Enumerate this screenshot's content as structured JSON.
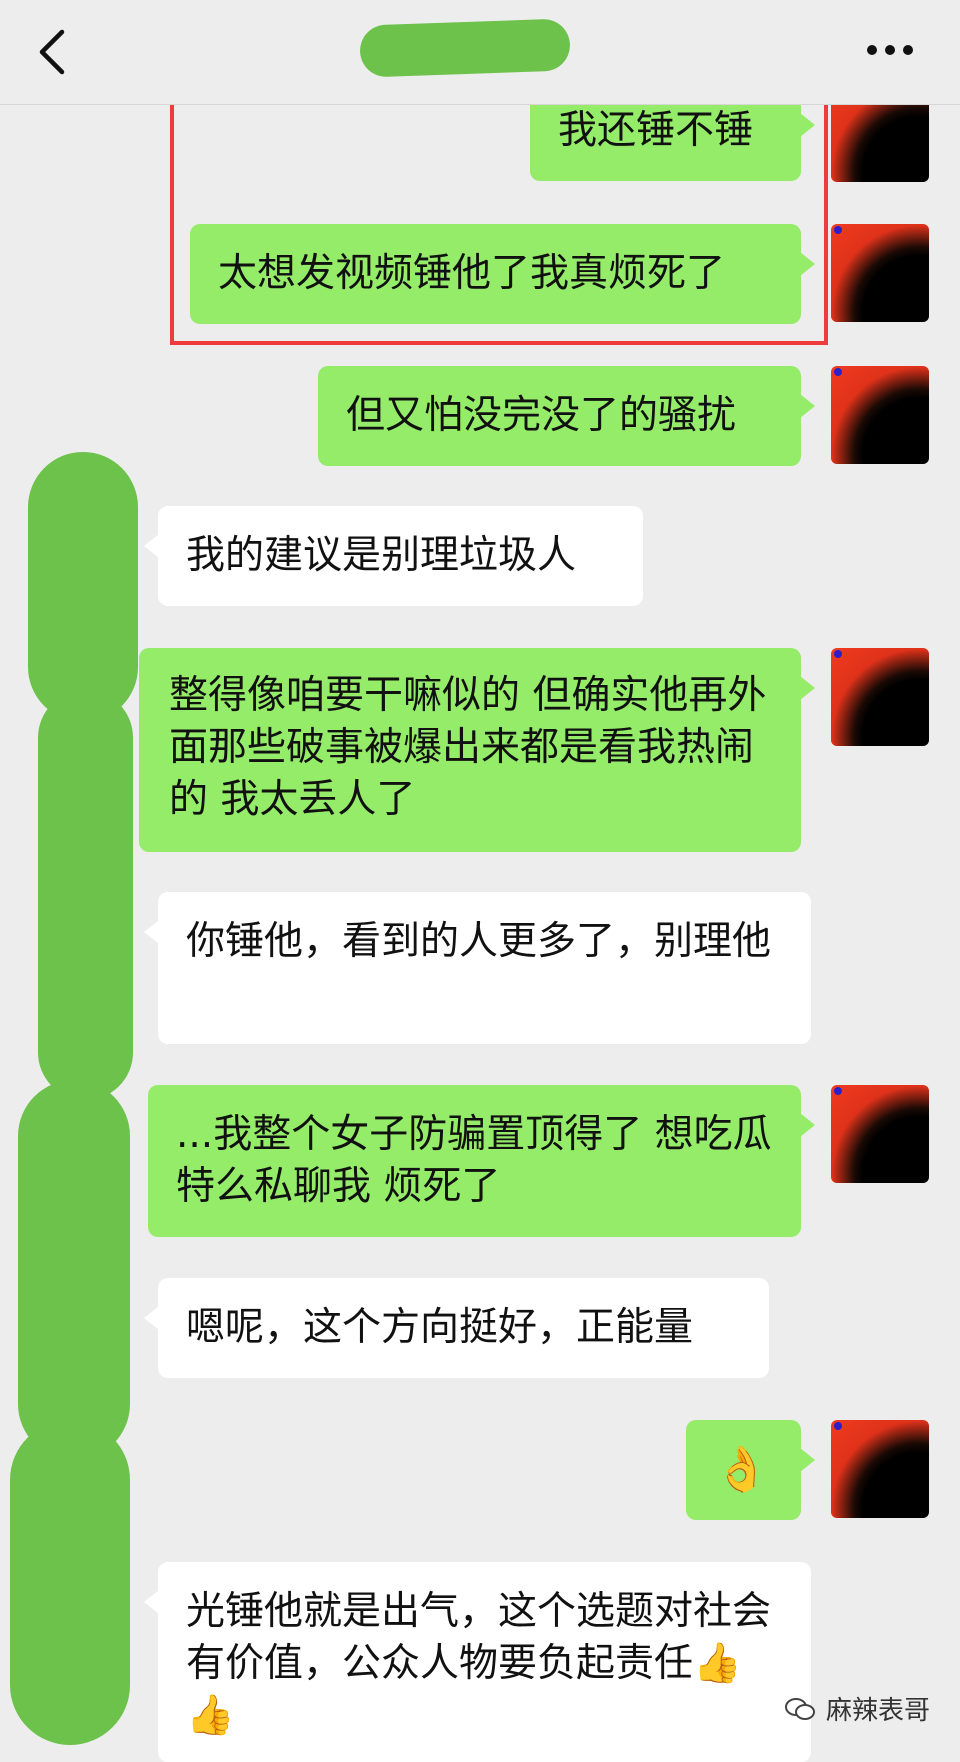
{
  "header": {
    "title": "",
    "back_icon": "chevron-left-icon",
    "more_icon": "more-horizontal-icon"
  },
  "messages": [
    {
      "sender": "self",
      "text": "我还锤不锤"
    },
    {
      "sender": "self",
      "text": "太想发视频锤他了我真烦死了"
    },
    {
      "sender": "self",
      "text": "但又怕没完没了的骚扰"
    },
    {
      "sender": "peer",
      "text": "我的建议是别理垃圾人"
    },
    {
      "sender": "self",
      "text": "整得像咱要干嘛似的 但确实他再外面那些破事被爆出来都是看我热闹的 我太丢人了"
    },
    {
      "sender": "peer",
      "text": "你锤他，看到的人更多了，别理他"
    },
    {
      "sender": "self",
      "text": "...我整个女子防骗置顶得了 想吃瓜特么私聊我 烦死了"
    },
    {
      "sender": "peer",
      "text": "嗯呢，这个方向挺好，正能量"
    },
    {
      "sender": "self",
      "text": "👌"
    },
    {
      "sender": "peer",
      "text": "光锤他就是出气，这个选题对社会有价值，公众人物要负起责任👍👍"
    }
  ],
  "watermark": {
    "icon": "wechat-icon",
    "text": "麻辣表哥"
  },
  "colors": {
    "self_bubble": "#95ec69",
    "peer_bubble": "#ffffff",
    "background": "#ededed",
    "highlight": "#ee3b3b",
    "redaction": "#6cc24a"
  }
}
